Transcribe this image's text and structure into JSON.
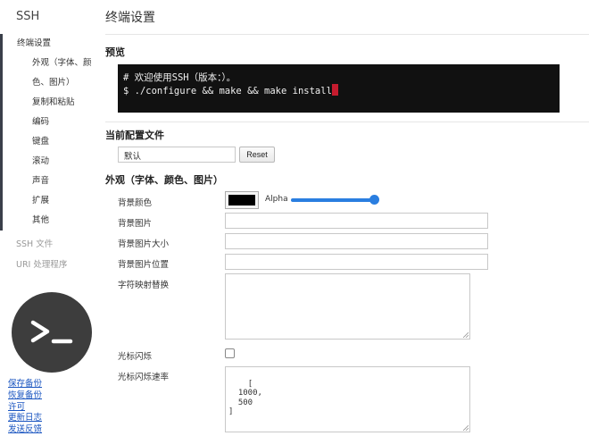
{
  "sidebar": {
    "app_title": "SSH",
    "items": [
      {
        "label": "终端设置"
      },
      {
        "label": "外观（字体、颜"
      },
      {
        "label": "色、图片）"
      },
      {
        "label": "复制和粘贴"
      },
      {
        "label": "编码"
      },
      {
        "label": "键盘"
      },
      {
        "label": "滚动"
      },
      {
        "label": "声音"
      },
      {
        "label": "扩展"
      },
      {
        "label": "其他"
      }
    ],
    "other_items": [
      {
        "label": "SSH 文件"
      },
      {
        "label": "URI 处理程序"
      }
    ],
    "logo_icon": "terminal-prompt-icon",
    "footer_links": [
      {
        "label": "保存备份"
      },
      {
        "label": "恢复备份"
      },
      {
        "label": "许可"
      },
      {
        "label": "更新日志"
      },
      {
        "label": "发送反馈"
      }
    ]
  },
  "main": {
    "page_title": "终端设置",
    "preview": {
      "title": "预览",
      "line1": "# 欢迎使用SSH（版本：）。",
      "line2": "$ ./configure && make && make install"
    },
    "profile": {
      "title": "当前配置文件",
      "value": "默认",
      "reset_label": "Reset"
    },
    "appearance": {
      "title": "外观（字体、颜色、图片）",
      "bg_color_label": "背景颜色",
      "bg_color": "#000000",
      "alpha_label": "Alpha",
      "alpha_value": 1.0,
      "bg_image_label": "背景图片",
      "bg_image_size_label": "背景图片大小",
      "bg_image_pos_label": "背景图片位置",
      "charmap_label": "字符映射替换",
      "cursor_blink_label": "光标闪烁",
      "cursor_blink_checked": false,
      "cursor_blink_rate_label": "光标闪烁速率",
      "cursor_blink_rate_value": "[\n  1000,\n  500\n]"
    }
  },
  "colors": {
    "terminal_bg": "#111111",
    "cursor": "#c51b2e",
    "accent": "#2a7ee0",
    "link": "#1a55c0"
  }
}
